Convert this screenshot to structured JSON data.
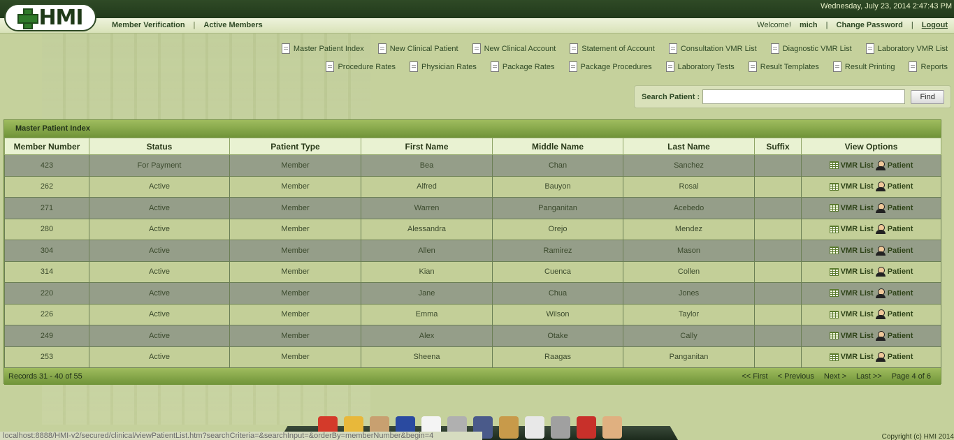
{
  "header": {
    "datetime": "Wednesday, July 23, 2014 2:47:43 PM",
    "logo_text": "HMI"
  },
  "nav": {
    "left": [
      "Member Verification",
      "Active Members"
    ],
    "welcome": "Welcome!",
    "username": "mich",
    "change_password": "Change Password",
    "logout": "Logout"
  },
  "menu": {
    "row1": [
      "Master Patient Index",
      "New Clinical Patient",
      "New Clinical Account",
      "Statement of Account",
      "Consultation VMR List",
      "Diagnostic VMR List",
      "Laboratory VMR List"
    ],
    "row2": [
      "Procedure Rates",
      "Physician Rates",
      "Package Rates",
      "Package Procedures",
      "Laboratory Tests",
      "Result Templates",
      "Result Printing",
      "Reports"
    ]
  },
  "search": {
    "label": "Search Patient :",
    "value": "",
    "button": "Find"
  },
  "panel": {
    "title": "Master Patient Index",
    "columns": [
      "Member Number",
      "Status",
      "Patient Type",
      "First Name",
      "Middle Name",
      "Last Name",
      "Suffix",
      "View Options"
    ],
    "rows": [
      {
        "member": "423",
        "status": "For Payment",
        "type": "Member",
        "first": "Bea",
        "middle": "Chan",
        "last": "Sanchez",
        "suffix": ""
      },
      {
        "member": "262",
        "status": "Active",
        "type": "Member",
        "first": "Alfred",
        "middle": "Bauyon",
        "last": "Rosal",
        "suffix": ""
      },
      {
        "member": "271",
        "status": "Active",
        "type": "Member",
        "first": "Warren",
        "middle": "Panganitan",
        "last": "Acebedo",
        "suffix": ""
      },
      {
        "member": "280",
        "status": "Active",
        "type": "Member",
        "first": "Alessandra",
        "middle": "Orejo",
        "last": "Mendez",
        "suffix": ""
      },
      {
        "member": "304",
        "status": "Active",
        "type": "Member",
        "first": "Allen",
        "middle": "Ramirez",
        "last": "Mason",
        "suffix": ""
      },
      {
        "member": "314",
        "status": "Active",
        "type": "Member",
        "first": "Kian",
        "middle": "Cuenca",
        "last": "Collen",
        "suffix": ""
      },
      {
        "member": "220",
        "status": "Active",
        "type": "Member",
        "first": "Jane",
        "middle": "Chua",
        "last": "Jones",
        "suffix": ""
      },
      {
        "member": "226",
        "status": "Active",
        "type": "Member",
        "first": "Emma",
        "middle": "Wilson",
        "last": "Taylor",
        "suffix": ""
      },
      {
        "member": "249",
        "status": "Active",
        "type": "Member",
        "first": "Alex",
        "middle": "Otake",
        "last": "Cally",
        "suffix": ""
      },
      {
        "member": "253",
        "status": "Active",
        "type": "Member",
        "first": "Sheena",
        "middle": "Raagas",
        "last": "Panganitan",
        "suffix": ""
      }
    ],
    "vmr_label": "VMR List",
    "patient_label": "Patient",
    "records": "Records  31 - 40  of  55",
    "pager": [
      "<< First",
      "< Previous",
      "Next >",
      "Last >>",
      "Page  4 of  6"
    ]
  },
  "statusbar": {
    "url": "localhost:8888/HMI-v2/secured/clinical/viewPatientList.htm?searchCriteria=&searchInput=&orderBy=memberNumber&begin=4",
    "copyright": "Copyright (c) HMI 2014"
  },
  "dock": {
    "icons": [
      "home-icon",
      "folder-icon",
      "people-icon",
      "pen-icon",
      "document-icon",
      "cash-register-icon",
      "stethoscope-icon",
      "clipboard-icon",
      "first-aid-icon",
      "calculator-icon",
      "hospital-icon",
      "doctor-icon"
    ]
  },
  "colors": {
    "topbar": "#2f4a26",
    "panel_header": "#7c9c45",
    "row_dark": "#959e89",
    "row_light": "#c3cf98"
  }
}
